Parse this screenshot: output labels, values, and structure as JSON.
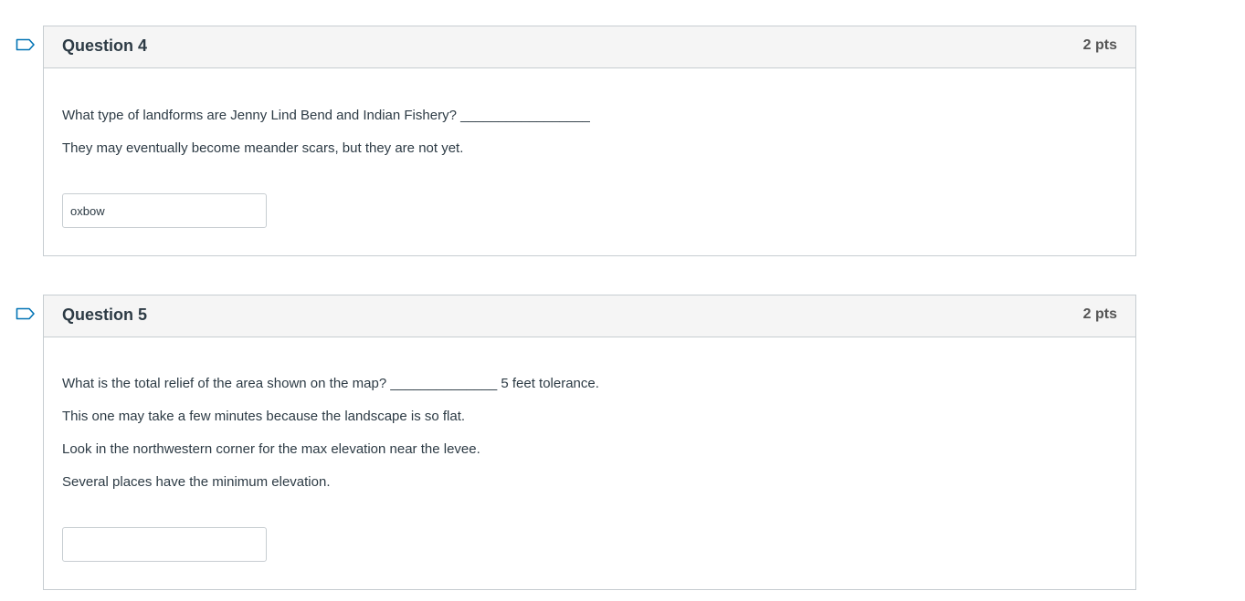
{
  "questions": [
    {
      "title": "Question 4",
      "points": "2 pts",
      "lines": [
        "What type of landforms are Jenny Lind Bend and Indian Fishery? _________________",
        "They may eventually become meander scars, but they are not yet."
      ],
      "answer_value": "oxbow",
      "flag_icon": "flag-outline-icon"
    },
    {
      "title": "Question 5",
      "points": "2 pts",
      "lines": [
        "What is the total relief of the area shown on the map? ______________  5 feet tolerance.",
        "This one may take a few minutes because the landscape is so flat.",
        "Look in the northwestern corner for the max elevation near the levee.",
        "Several places have the minimum elevation."
      ],
      "answer_value": "",
      "flag_icon": "flag-outline-icon"
    }
  ],
  "colors": {
    "border": "#c7cdd1",
    "header_bg": "#f5f5f5",
    "text": "#2d3b45",
    "flag": "#0374b5"
  }
}
